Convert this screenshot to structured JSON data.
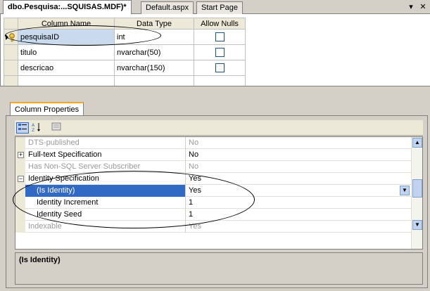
{
  "tabs": [
    {
      "label": "dbo.Pesquisa:...SQUISAS.MDF)*",
      "active": true
    },
    {
      "label": "Default.aspx",
      "active": false
    },
    {
      "label": "Start Page",
      "active": false
    }
  ],
  "tab_controls": {
    "dropdown": "▾",
    "close": "✕"
  },
  "designer": {
    "headers": {
      "name": "Column Name",
      "type": "Data Type",
      "nulls": "Allow Nulls"
    },
    "rows": [
      {
        "name": "pesquisaID",
        "type": "int",
        "allow_nulls": false,
        "primary_key": true
      },
      {
        "name": "titulo",
        "type": "nvarchar(50)",
        "allow_nulls": false
      },
      {
        "name": "descricao",
        "type": "nvarchar(150)",
        "allow_nulls": false
      },
      {
        "name": "",
        "type": "",
        "allow_nulls": null
      }
    ]
  },
  "properties": {
    "tab_label": "Column Properties",
    "rows": [
      {
        "label": "DTS-published",
        "value": "No",
        "dim": true
      },
      {
        "label": "Full-text Specification",
        "value": "No",
        "expander": "+"
      },
      {
        "label": "Has Non-SQL Server Subscriber",
        "value": "No",
        "dim": true
      },
      {
        "label": "Identity Specification",
        "value": "Yes",
        "expander": "−"
      },
      {
        "label": "(Is Identity)",
        "value": "Yes",
        "indent": true,
        "selected": true
      },
      {
        "label": "Identity Increment",
        "value": "1",
        "indent": true
      },
      {
        "label": "Identity Seed",
        "value": "1",
        "indent": true
      },
      {
        "label": "Indexable",
        "value": "Yes",
        "dim": true
      }
    ],
    "description": "(Is Identity)"
  },
  "colors": {
    "selection": "#316ac5",
    "accent_tab": "#f5a623"
  }
}
